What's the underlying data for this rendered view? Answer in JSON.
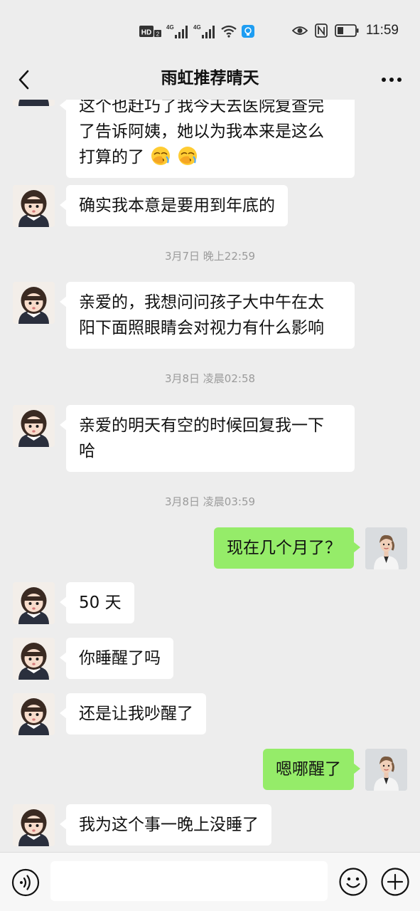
{
  "status_bar": {
    "hd_label": "HD",
    "hd_sub": "2",
    "net1": "4G",
    "net2": "4G",
    "time": "11:59"
  },
  "header": {
    "title": "雨虹推荐晴天"
  },
  "messages": [
    {
      "side": "left",
      "lines": [
        "这个也赶巧了我今天去医院复查完",
        "了告诉阿姨，她以为我本来是这么",
        "打算的了"
      ],
      "emoji": [
        "facepalm-emoji",
        "facepalm-emoji"
      ]
    },
    {
      "side": "left",
      "text": "确实我本意是要用到年底的"
    },
    {
      "type": "time",
      "text": "3月7日 晚上22:59"
    },
    {
      "side": "left",
      "lines": [
        "亲爱的，我想问问孩子大中午在太",
        "阳下面照眼睛会对视力有什么影响"
      ]
    },
    {
      "type": "time",
      "text": "3月8日 凌晨02:58"
    },
    {
      "side": "left",
      "lines": [
        "亲爱的明天有空的时候回复我一下",
        "哈"
      ]
    },
    {
      "type": "time",
      "text": "3月8日 凌晨03:59"
    },
    {
      "side": "right",
      "text": "现在几个月了？"
    },
    {
      "side": "left",
      "text": "50 天"
    },
    {
      "side": "left",
      "text": "你睡醒了吗"
    },
    {
      "side": "left",
      "text": "还是让我吵醒了"
    },
    {
      "side": "right",
      "text": "嗯哪醒了"
    },
    {
      "side": "left",
      "text": "我为这个事一晚上没睡了"
    }
  ],
  "colors": {
    "background": "#ededed",
    "bubble_self": "#95ec69",
    "bubble_other": "#ffffff",
    "timestamp": "#9b9b9b"
  },
  "input_bar": {
    "voice_icon": "voice-icon",
    "emoji_icon": "emoji-icon",
    "plus_icon": "plus-icon"
  }
}
